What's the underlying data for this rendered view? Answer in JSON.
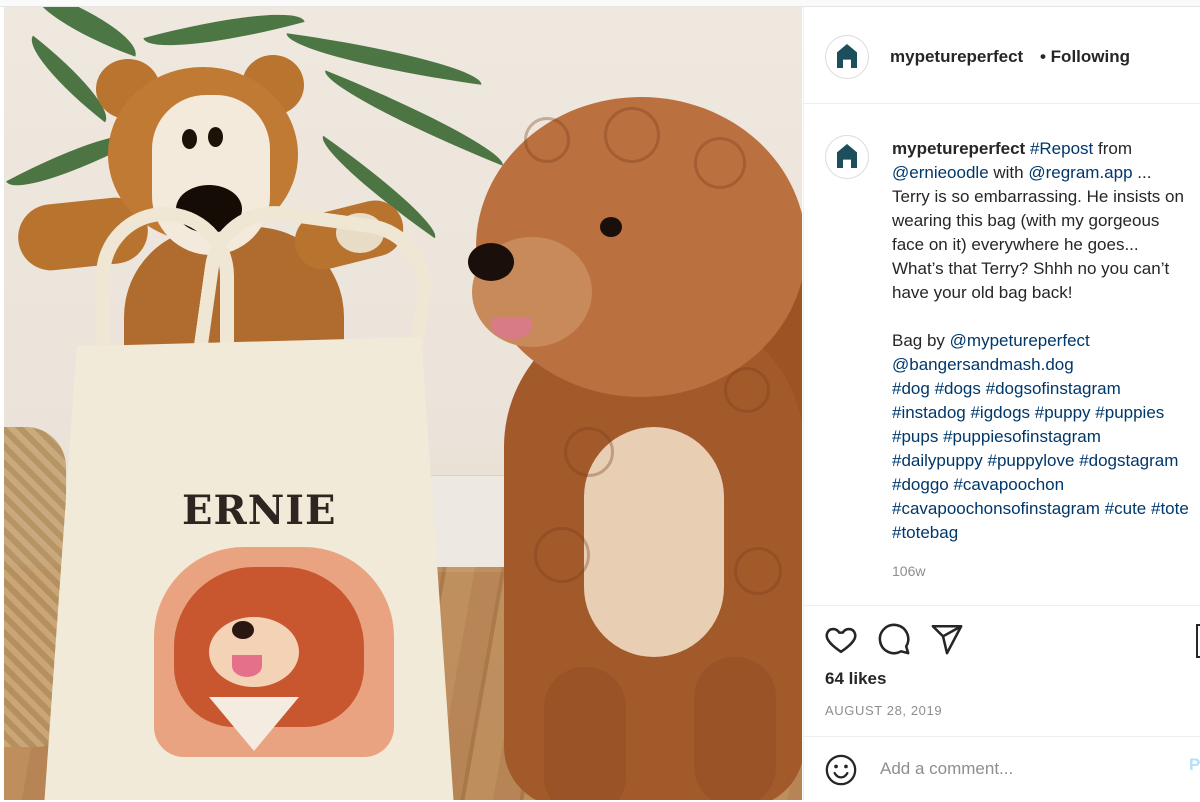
{
  "post": {
    "image": {
      "bag_text": "ERNIE"
    },
    "header": {
      "username": "mypetureperfect",
      "follow_status": "• Following"
    },
    "caption": {
      "username": "mypetureperfect",
      "lines": [
        [
          {
            "t": "#Repost",
            "tag": true
          },
          {
            "t": " from",
            "tag": false
          }
        ],
        [
          {
            "t": "@ernieoodle",
            "tag": true
          },
          {
            "t": " with ",
            "tag": false
          },
          {
            "t": "@regram.app",
            "tag": true
          },
          {
            "t": " ...",
            "tag": false
          }
        ],
        [
          {
            "t": "Terry is so embarrassing. He insists on",
            "tag": false
          }
        ],
        [
          {
            "t": "wearing this bag (with my gorgeous",
            "tag": false
          }
        ],
        [
          {
            "t": "face on it) everywhere he goes...",
            "tag": false
          }
        ],
        [
          {
            "t": "What’s that Terry? Shhh no you can’t",
            "tag": false
          }
        ],
        [
          {
            "t": "have your old bag back!",
            "tag": false
          }
        ],
        [],
        [
          {
            "t": "Bag by ",
            "tag": false
          },
          {
            "t": "@mypetureperfect",
            "tag": true
          }
        ],
        [
          {
            "t": "@bangersandmash.dog",
            "tag": true
          }
        ],
        [
          {
            "t": "#dog",
            "tag": true
          },
          {
            "t": " ",
            "tag": false
          },
          {
            "t": "#dogs",
            "tag": true
          },
          {
            "t": " ",
            "tag": false
          },
          {
            "t": "#dogsofinstagram",
            "tag": true
          }
        ],
        [
          {
            "t": "#instadog",
            "tag": true
          },
          {
            "t": " ",
            "tag": false
          },
          {
            "t": "#igdogs",
            "tag": true
          },
          {
            "t": " ",
            "tag": false
          },
          {
            "t": "#puppy",
            "tag": true
          },
          {
            "t": " ",
            "tag": false
          },
          {
            "t": "#puppies",
            "tag": true
          }
        ],
        [
          {
            "t": "#pups",
            "tag": true
          },
          {
            "t": " ",
            "tag": false
          },
          {
            "t": "#puppiesofinstagram",
            "tag": true
          }
        ],
        [
          {
            "t": "#dailypuppy",
            "tag": true
          },
          {
            "t": " ",
            "tag": false
          },
          {
            "t": "#puppylove",
            "tag": true
          },
          {
            "t": " ",
            "tag": false
          },
          {
            "t": "#dogstagram",
            "tag": true
          }
        ],
        [
          {
            "t": "#doggo",
            "tag": true
          },
          {
            "t": " ",
            "tag": false
          },
          {
            "t": "#cavapoochon",
            "tag": true
          }
        ],
        [
          {
            "t": "#cavapoochonsofinstagram",
            "tag": true
          },
          {
            "t": " ",
            "tag": false
          },
          {
            "t": "#cute",
            "tag": true
          },
          {
            "t": " ",
            "tag": false
          },
          {
            "t": "#tote",
            "tag": true
          }
        ],
        [
          {
            "t": "#totebag",
            "tag": true
          }
        ]
      ],
      "time_ago": "106w"
    },
    "actions": {
      "like_icon": "heart-icon",
      "comment_icon": "speech-bubble-icon",
      "share_icon": "paper-plane-icon",
      "save_icon": "bookmark-icon",
      "likes_text": "64 likes",
      "date": "AUGUST 28, 2019"
    },
    "comment": {
      "emoji_icon": "smiley-icon",
      "placeholder": "Add a comment...",
      "post_label": "Post"
    }
  },
  "colors": {
    "link": "#00376b",
    "text": "#262626",
    "muted": "#8e8e8e",
    "post_disabled": "#b2dffc"
  }
}
